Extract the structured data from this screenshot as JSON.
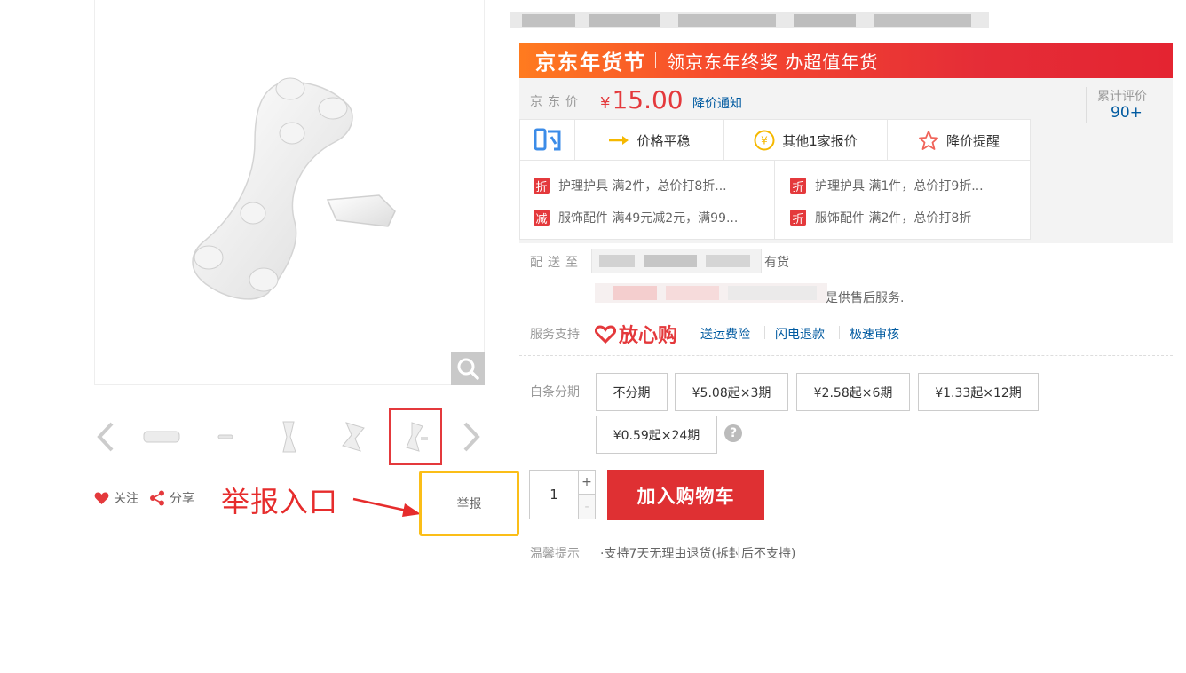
{
  "product": {
    "rating_label": "累计评价",
    "rating_value": "90+"
  },
  "banner": {
    "title": "京东年货节",
    "subtitle": "领京东年终奖 办超值年货"
  },
  "price": {
    "label": "京东价",
    "currency": "¥",
    "value": "15.00",
    "notice": "降价通知"
  },
  "tools": [
    {
      "label": "",
      "icon": "gou-icon"
    },
    {
      "label": "价格平稳",
      "icon": "arrow-right-icon"
    },
    {
      "label": "其他1家报价",
      "icon": "yen-coin-icon"
    },
    {
      "label": "降价提醒",
      "icon": "star-outline-icon"
    }
  ],
  "promotions": [
    {
      "tag": "折",
      "text": "护理护具 满2件，总价打8折..."
    },
    {
      "tag": "折",
      "text": "护理护具 满1件，总价打9折..."
    },
    {
      "tag": "减",
      "text": "服饰配件 满49元减2元，满99..."
    },
    {
      "tag": "折",
      "text": "服饰配件 满2件，总价打8折"
    }
  ],
  "delivery": {
    "label": "配送至",
    "stock": "有货",
    "service_tail": "是供售后服务."
  },
  "service": {
    "label": "服务支持",
    "brand": "放心购",
    "links": [
      "送运费险",
      "闪电退款",
      "极速审核"
    ]
  },
  "baitiao": {
    "label": "白条分期",
    "options": [
      "不分期",
      "¥5.08起×3期",
      "¥2.58起×6期",
      "¥1.33起×12期",
      "¥0.59起×24期"
    ],
    "help": "?"
  },
  "cart": {
    "quantity": "1",
    "plus": "+",
    "minus": "-",
    "button": "加入购物车"
  },
  "tip": {
    "label": "温馨提示",
    "text": "·支持7天无理由退货(拆封后不支持)"
  },
  "actions": {
    "follow": "关注",
    "share": "分享",
    "report": "举报"
  },
  "annotation": {
    "text": "举报入口"
  },
  "colors": {
    "accent_red": "#e4393c",
    "link_blue": "#005aa0",
    "highlight_yellow": "#fbbe18"
  }
}
